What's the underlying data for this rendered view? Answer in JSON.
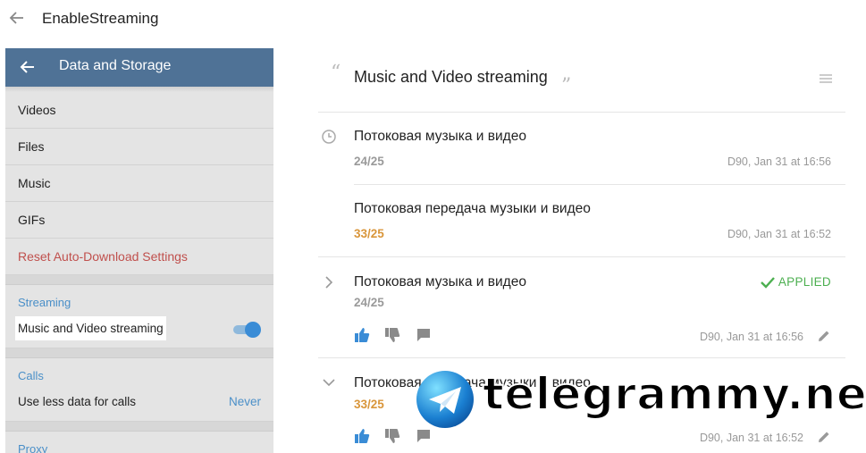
{
  "window": {
    "title": "EnableStreaming"
  },
  "phone": {
    "header_title": "Data and Storage",
    "auto_download_items": [
      "Videos",
      "Files",
      "Music",
      "GIFs"
    ],
    "reset_label": "Reset Auto-Download Settings",
    "streaming": {
      "section_title": "Streaming",
      "setting_label": "Music and Video streaming",
      "toggle_on": true
    },
    "calls": {
      "section_title": "Calls",
      "setting_label": "Use less data for calls",
      "setting_value": "Never"
    },
    "proxy": {
      "section_title": "Proxy"
    }
  },
  "translation": {
    "source_string": "Music and Video streaming",
    "suggestions": [
      {
        "text": "Потоковая музыка и видео",
        "count": "24/25",
        "meta": "D90, Jan 31 at 16:56",
        "status": ""
      },
      {
        "text": "Потоковая передача музыки и видео",
        "count": "33/25",
        "meta": "D90, Jan 31 at 16:52",
        "status": ""
      },
      {
        "text": "Потоковая музыка и видео",
        "count": "24/25",
        "meta": "D90, Jan 31 at 16:56",
        "status": "APPLIED"
      },
      {
        "text": "Потоковая передача музыки и видео",
        "count": "33/25",
        "meta": "D90, Jan 31 at 16:52",
        "status": ""
      }
    ]
  },
  "colors": {
    "header_blue": "#4f7296",
    "link_blue": "#4a8fc8",
    "reset_red": "#c0504d",
    "applied_green": "#4caf50",
    "over_limit_orange": "#d9963b"
  },
  "icons": [
    "back-arrow-icon",
    "menu-lines-icon",
    "clock-icon",
    "chevron-right-icon",
    "chevron-down-icon",
    "check-icon",
    "thumbs-up-icon",
    "thumbs-down-icon",
    "comment-icon",
    "pencil-icon"
  ],
  "watermark": {
    "text": "telegrammy.net"
  }
}
